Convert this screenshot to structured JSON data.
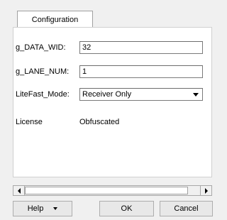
{
  "tabs": [
    {
      "label": "Configuration"
    }
  ],
  "params": [
    {
      "label": "g_DATA_WID:",
      "value": "32"
    },
    {
      "label": "g_LANE_NUM:",
      "value": "1"
    },
    {
      "label": "LiteFast_Mode:",
      "value": "Receiver Only"
    }
  ],
  "license": {
    "label": "License",
    "value": "Obfuscated"
  },
  "buttons": {
    "help": "Help",
    "ok": "OK",
    "cancel": "Cancel"
  },
  "icons": {
    "dropdown": "chevron-down-icon",
    "scroll_left": "arrow-left-icon",
    "scroll_right": "arrow-right-icon"
  }
}
